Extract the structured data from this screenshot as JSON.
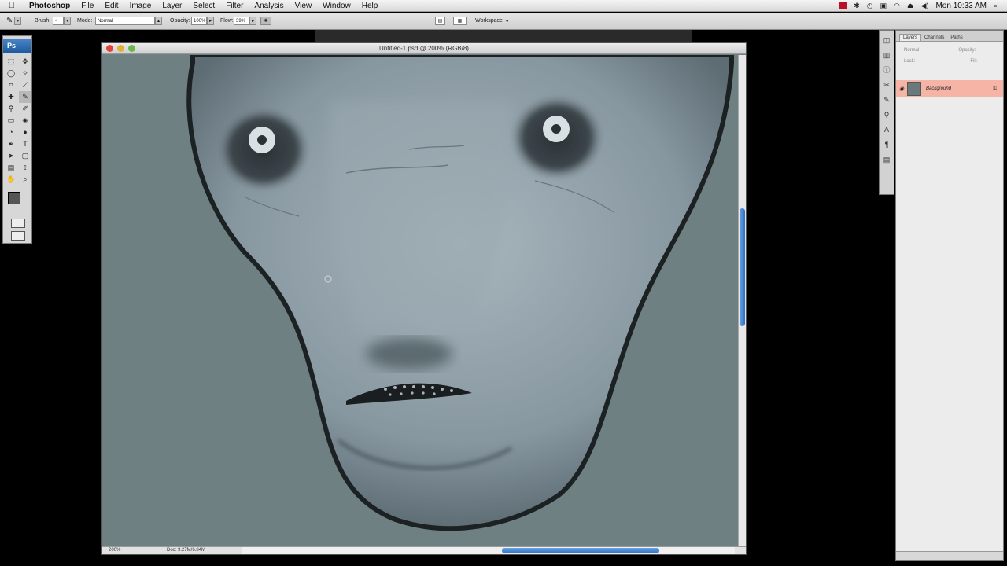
{
  "menubar": {
    "apple": "",
    "items": [
      "Photoshop",
      "File",
      "Edit",
      "Image",
      "Layer",
      "Select",
      "Filter",
      "Analysis",
      "View",
      "Window",
      "Help"
    ],
    "clock": "Mon 10:33 AM"
  },
  "options": {
    "brush_label": "Brush:",
    "mode_label": "Mode:",
    "mode_value": "Normal",
    "opacity_label": "Opacity:",
    "opacity_value": "100%",
    "flow_label": "Flow:",
    "flow_value": "39%",
    "workspace_label": "Workspace"
  },
  "tools": {
    "app_badge": "Ps"
  },
  "document": {
    "title": "Untitled-1.psd @ 200% (RGB/8)",
    "zoom": "200%",
    "doc_size": "Doc: 9.27M/6.84M"
  },
  "layers": {
    "tabs": [
      "Layers",
      "Channels",
      "Paths"
    ],
    "blend": "Normal",
    "opacity_label": "Opacity:",
    "lock_label": "Lock:",
    "fill_label": "Fill:",
    "layer_name": "Background"
  },
  "colors": {
    "canvas_bg": "#6e8081",
    "selected_layer": "#f5b4a6",
    "scroll_thumb": "#2d6ec8"
  }
}
